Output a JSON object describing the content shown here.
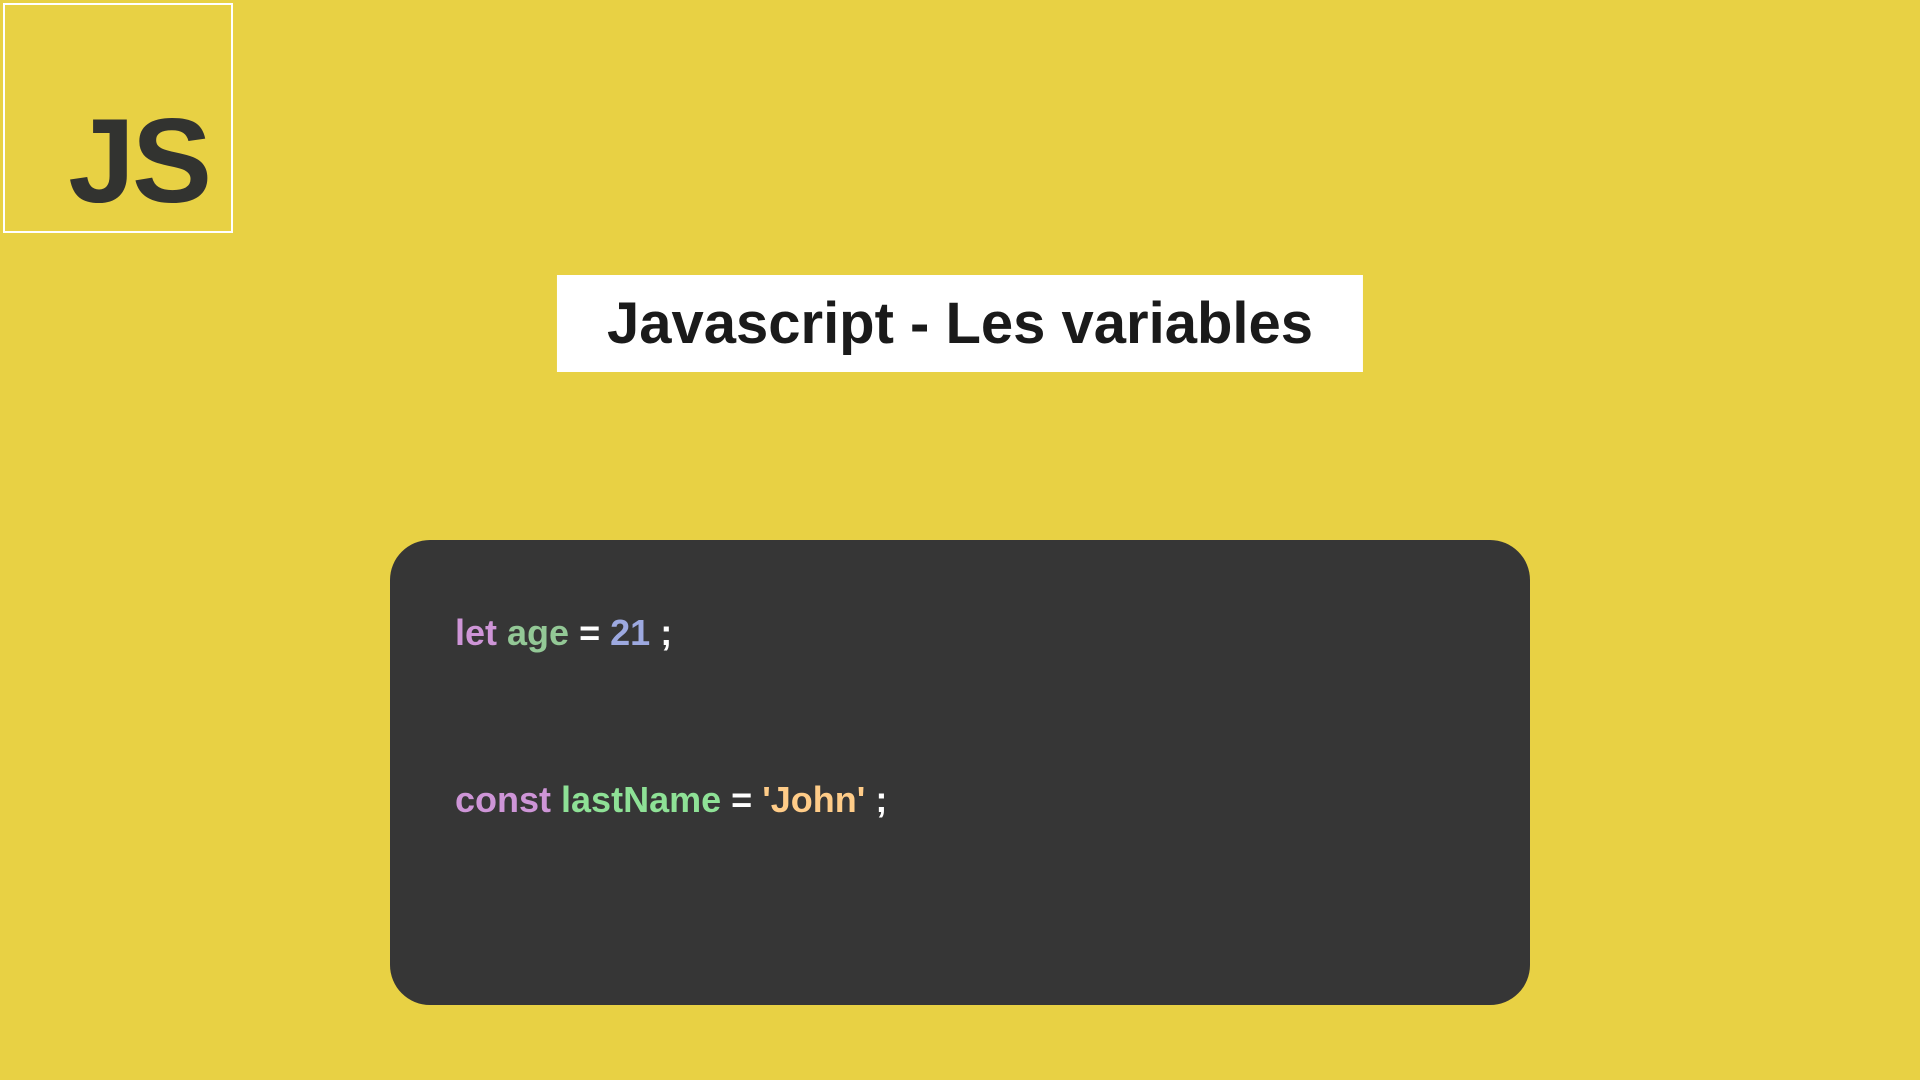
{
  "logo": {
    "text": "JS"
  },
  "title": "Javascript - Les variables",
  "code": {
    "line1": {
      "keyword": "let",
      "identifier": "age",
      "operator": "=",
      "value": "21",
      "semicolon": ";"
    },
    "line2": {
      "keyword": "const",
      "identifier": "lastName",
      "operator": "=",
      "value": "'John'",
      "semicolon": ";"
    }
  }
}
